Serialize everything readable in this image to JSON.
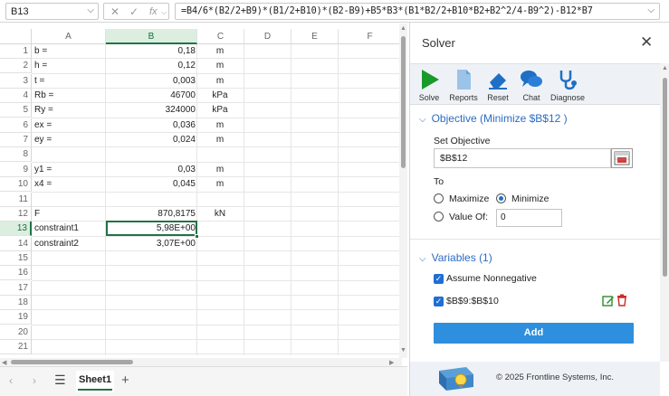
{
  "formula_bar": {
    "name_box": "B13",
    "formula": "=B4/6*(B2/2+B9)*(B1/2+B10)*(B2-B9)+B5*B3*(B1*B2/2+B10*B2+B2^2/4-B9^2)-B12*B7"
  },
  "columns": [
    "A",
    "B",
    "C",
    "D",
    "E",
    "F"
  ],
  "rows": [
    {
      "n": "1",
      "a": "b =",
      "b": "0,18",
      "c": "m"
    },
    {
      "n": "2",
      "a": "h =",
      "b": "0,12",
      "c": "m"
    },
    {
      "n": "3",
      "a": "t =",
      "b": "0,003",
      "c": "m"
    },
    {
      "n": "4",
      "a": "Rb =",
      "b": "46700",
      "c": "kPa"
    },
    {
      "n": "5",
      "a": "Ry =",
      "b": "324000",
      "c": "kPa"
    },
    {
      "n": "6",
      "a": "ex =",
      "b": "0,036",
      "c": "m"
    },
    {
      "n": "7",
      "a": "ey =",
      "b": "0,024",
      "c": "m"
    },
    {
      "n": "8",
      "a": "",
      "b": "",
      "c": ""
    },
    {
      "n": "9",
      "a": "y1 =",
      "b": "0,03",
      "c": "m"
    },
    {
      "n": "10",
      "a": "x4 =",
      "b": "0,045",
      "c": "m"
    },
    {
      "n": "11",
      "a": "",
      "b": "",
      "c": ""
    },
    {
      "n": "12",
      "a": "F",
      "b": "870,8175",
      "c": "kN"
    },
    {
      "n": "13",
      "a": "constraint1",
      "b": "5,98E+00",
      "c": ""
    },
    {
      "n": "14",
      "a": "constraint2",
      "b": "3,07E+00",
      "c": ""
    },
    {
      "n": "15",
      "a": "",
      "b": "",
      "c": ""
    },
    {
      "n": "16",
      "a": "",
      "b": "",
      "c": ""
    },
    {
      "n": "17",
      "a": "",
      "b": "",
      "c": ""
    },
    {
      "n": "18",
      "a": "",
      "b": "",
      "c": ""
    },
    {
      "n": "19",
      "a": "",
      "b": "",
      "c": ""
    },
    {
      "n": "20",
      "a": "",
      "b": "",
      "c": ""
    },
    {
      "n": "21",
      "a": "",
      "b": "",
      "c": ""
    }
  ],
  "sheet_tabs": {
    "active": "Sheet1",
    "add": "+",
    "menu": "☰"
  },
  "solver": {
    "title": "Solver",
    "close": "✕",
    "ribbon": [
      {
        "key": "solve",
        "label": "Solve",
        "icon": "play-icon"
      },
      {
        "key": "reports",
        "label": "Reports",
        "icon": "report-icon"
      },
      {
        "key": "reset",
        "label": "Reset",
        "icon": "eraser-icon"
      },
      {
        "key": "chat",
        "label": "Chat",
        "icon": "chat-icon"
      },
      {
        "key": "diagnose",
        "label": "Diagnose",
        "icon": "stethoscope-icon"
      }
    ],
    "objective": {
      "header": "Objective (Minimize $B$12 )",
      "set_label": "Set Objective",
      "value": "$B$12",
      "to_label": "To",
      "maximize": "Maximize",
      "minimize": "Minimize",
      "selected": "minimize",
      "value_of_label": "Value Of:",
      "value_of": "0"
    },
    "variables": {
      "header": "Variables (1)",
      "assume_nonneg": "Assume Nonnegative",
      "assume_nonneg_checked": true,
      "range": "$B$9:$B$10",
      "range_checked": true
    },
    "add_button": "Add",
    "footer": "© 2025 Frontline Systems, Inc."
  },
  "colors": {
    "excel_green": "#217346",
    "solver_blue": "#2b6cc4",
    "add_button": "#2e8fde",
    "solve_green": "#1a9a2a"
  }
}
